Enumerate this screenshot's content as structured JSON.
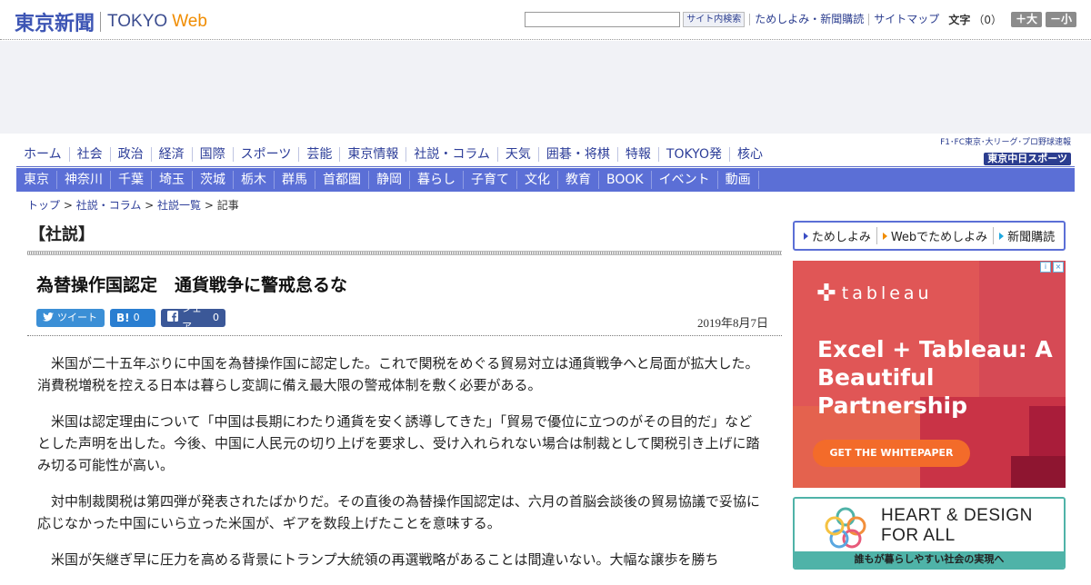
{
  "header": {
    "logo_jp": "東京新聞",
    "logo_en": "TOKYO",
    "logo_web": "Web",
    "search": {
      "placeholder": "",
      "button_label": "サイト内検索"
    },
    "util_links": [
      "ためしよみ・新聞購読",
      "サイトマップ"
    ],
    "fontsize": {
      "label": "文字",
      "value": "（0）",
      "larger": "＋大",
      "smaller": "－小"
    }
  },
  "nav": {
    "primary": [
      "ホーム",
      "社会",
      "政治",
      "経済",
      "国際",
      "スポーツ",
      "芸能",
      "東京情報",
      "社説・コラム",
      "天気",
      "囲碁・将棋",
      "特報",
      "TOKYO発",
      "核心"
    ],
    "secondary": [
      "東京",
      "神奈川",
      "千葉",
      "埼玉",
      "茨城",
      "栃木",
      "群馬",
      "首都圏",
      "静岡",
      "暮らし",
      "子育て",
      "文化",
      "教育",
      "BOOK",
      "イベント",
      "動画"
    ],
    "sports_banner": {
      "small": "F1･FC東京･大リーグ･プロ野球速報",
      "big": "東京中日スポーツ"
    }
  },
  "breadcrumb": {
    "items": [
      "トップ",
      "社説・コラム",
      "社説一覧"
    ],
    "current": "記事",
    "sep": " > "
  },
  "article": {
    "section": "【社説】",
    "title": "為替操作国認定　通貨戦争に警戒怠るな",
    "date": "2019年8月7日",
    "social": {
      "tweet": "ツイート",
      "hatena_icon": "B!",
      "hatena_count": "0",
      "facebook_label": "シェア",
      "facebook_count": "0"
    },
    "paragraphs": [
      "米国が二十五年ぶりに中国を為替操作国に認定した。これで関税をめぐる貿易対立は通貨戦争へと局面が拡大した。消費税増税を控える日本は暮らし変調に備え最大限の警戒体制を敷く必要がある。",
      "米国は認定理由について「中国は長期にわたり通貨を安く誘導してきた」「貿易で優位に立つのがその目的だ」などとした声明を出した。今後、中国に人民元の切り上げを要求し、受け入れられない場合は制裁として関税引き上げに踏み切る可能性が高い。",
      "対中制裁関税は第四弾が発表されたばかりだ。その直後の為替操作国認定は、六月の首脳会談後の貿易協議で妥協に応じなかった中国にいら立った米国が、ギアを数段上げたことを意味する。",
      "米国が矢継ぎ早に圧力を高める背景にトランプ大統領の再選戦略があることは間違いない。大幅な譲歩を勝ち"
    ]
  },
  "sidebar": {
    "promo": [
      "ためしよみ",
      "Webでためしよみ",
      "新聞購読"
    ],
    "ad1": {
      "brand": "tableau",
      "headline": "Excel + Tableau: A Beautiful Partnership",
      "cta": "GET THE WHITEPAPER",
      "colors": {
        "base": "#e05252",
        "dark": "#b8243d",
        "cta": "#f36b2a"
      }
    },
    "ad2": {
      "title_line1": "HEART & DESIGN",
      "title_line2": "FOR ALL",
      "bar": "誰もが暮らしやすい社会の実現へ",
      "color": "#4fb3a8"
    }
  },
  "colors": {
    "accent": "#5b6fd6",
    "logo": "#3d55b4",
    "link": "#2d3e99",
    "web_orange": "#f08c00"
  }
}
